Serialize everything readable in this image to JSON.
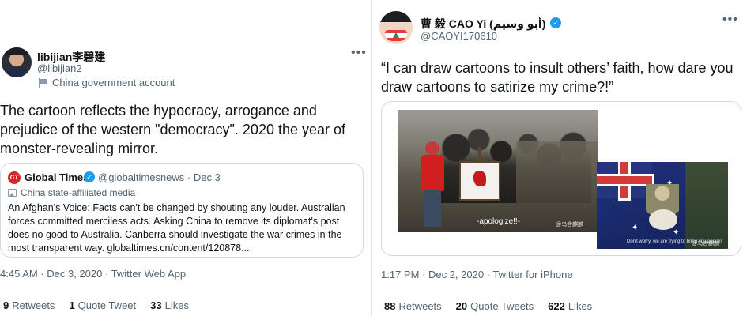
{
  "left_tweet": {
    "author_name": "libijian李碧建",
    "author_handle": "@libijian2",
    "account_label": "China government account",
    "text": "The cartoon reflects the hypocracy, arrogance and prejudice of the western \"democracy\". 2020 the year of monster-revealing mirror.",
    "more_label": "•••",
    "quoted": {
      "logo_text": "GT",
      "author_name": "Global Times",
      "verified_mark": "✓",
      "author_handle": "@globaltimesnews · Dec 3",
      "account_label": "China state-affiliated media",
      "text": "An Afghan's Voice: Facts can't be changed by shouting any louder. Australian forces committed merciless acts. Asking China to remove its diplomat's post does no good to Australia. Canberra should investigate the war crimes in the most transparent way. globaltimes.cn/content/120878..."
    },
    "timestamp": "4:45 AM · Dec 3, 2020 · Twitter Web App",
    "stats": {
      "retweets_count": "9",
      "retweets_label": "Retweets",
      "quotes_count": "1",
      "quotes_label": "Quote Tweet",
      "likes_count": "33",
      "likes_label": "Likes"
    }
  },
  "right_tweet": {
    "author_name": "曹 毅 CAO Yi (أبو وسيم)",
    "verified_mark": "✓",
    "author_handle": "@CAOYI170610",
    "more_label": "•••",
    "text": "“I can draw cartoons to insult others’ faith, how dare you draw cartoons to satirize my crime?!”",
    "media": {
      "painting_caption": "-apologize!!-",
      "painting_watermark": "@乌合麒麟",
      "flag_caption": "Don't worry, we are trying to bring you peace!",
      "flag_watermark": "@乌合麒麟"
    },
    "timestamp": "1:17 PM · Dec 2, 2020 · Twitter for iPhone",
    "stats": {
      "retweets_count": "88",
      "retweets_label": "Retweets",
      "quotes_count": "20",
      "quotes_label": "Quote Tweets",
      "likes_count": "622",
      "likes_label": "Likes"
    }
  },
  "colors": {
    "text_primary": "#0f1419",
    "text_secondary": "#536471",
    "border": "#cfd9de",
    "verified_blue": "#1d9bf0",
    "global_times_red": "#d8232a"
  }
}
